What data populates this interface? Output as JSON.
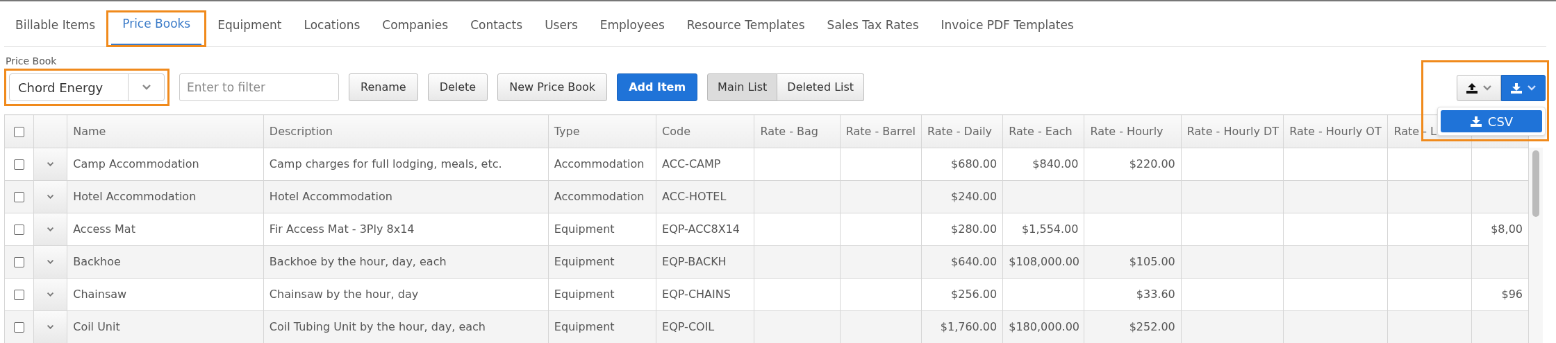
{
  "tabs": [
    {
      "label": "Billable Items",
      "selected": false,
      "highlighted": false
    },
    {
      "label": "Price Books",
      "selected": true,
      "highlighted": true
    },
    {
      "label": "Equipment",
      "selected": false,
      "highlighted": false
    },
    {
      "label": "Locations",
      "selected": false,
      "highlighted": false
    },
    {
      "label": "Companies",
      "selected": false,
      "highlighted": false
    },
    {
      "label": "Contacts",
      "selected": false,
      "highlighted": false
    },
    {
      "label": "Users",
      "selected": false,
      "highlighted": false
    },
    {
      "label": "Employees",
      "selected": false,
      "highlighted": false
    },
    {
      "label": "Resource Templates",
      "selected": false,
      "highlighted": false
    },
    {
      "label": "Sales Tax Rates",
      "selected": false,
      "highlighted": false
    },
    {
      "label": "Invoice PDF Templates",
      "selected": false,
      "highlighted": false
    }
  ],
  "price_book": {
    "label": "Price Book",
    "value": "Chord Energy",
    "highlighted": true
  },
  "filter": {
    "placeholder": "Enter to filter"
  },
  "buttons": [
    {
      "label": "Rename",
      "kind": "default"
    },
    {
      "label": "Delete",
      "kind": "default"
    },
    {
      "label": "New Price Book",
      "kind": "default"
    },
    {
      "label": "Add Item",
      "kind": "primary"
    }
  ],
  "list_toggle": [
    {
      "label": "Main List",
      "selected": true
    },
    {
      "label": "Deleted List",
      "selected": false
    }
  ],
  "export": {
    "highlighted": true,
    "menu": [
      {
        "label": "CSV"
      }
    ]
  },
  "table": {
    "all_checked": false,
    "columns": [
      "Name",
      "Description",
      "Type",
      "Code",
      "Rate - Bag",
      "Rate - Barrel",
      "Rate - Daily",
      "Rate - Each",
      "Rate - Hourly",
      "Rate - Hourly DT",
      "Rate - Hourly OT",
      "Rate - L"
    ],
    "rows": [
      {
        "checked": false,
        "cells": [
          "Camp Accommodation",
          "Camp charges for full lodging, meals, etc.",
          "Accommodation",
          "ACC-CAMP",
          null,
          null,
          "$680.00",
          "$840.00",
          "$220.00",
          null,
          null,
          null,
          null
        ]
      },
      {
        "checked": false,
        "cells": [
          "Hotel Accommodation",
          "Hotel Accommodation",
          "Accommodation",
          "ACC-HOTEL",
          null,
          null,
          "$240.00",
          null,
          null,
          null,
          null,
          null,
          null
        ]
      },
      {
        "checked": false,
        "cells": [
          "Access Mat",
          "Fir Access Mat - 3Ply 8x14",
          "Equipment",
          "EQP-ACC8X14",
          null,
          null,
          "$280.00",
          "$1,554.00",
          null,
          null,
          null,
          null,
          "$8,00"
        ]
      },
      {
        "checked": false,
        "cells": [
          "Backhoe",
          "Backhoe by the hour, day, each",
          "Equipment",
          "EQP-BACKH",
          null,
          null,
          "$640.00",
          "$108,000.00",
          "$105.00",
          null,
          null,
          null,
          null
        ]
      },
      {
        "checked": false,
        "cells": [
          "Chainsaw",
          "Chainsaw by the hour, day",
          "Equipment",
          "EQP-CHAINS",
          null,
          null,
          "$256.00",
          null,
          "$33.60",
          null,
          null,
          null,
          "$96"
        ]
      },
      {
        "checked": false,
        "cells": [
          "Coil Unit",
          "Coil Tubing Unit by the hour, day, each",
          "Equipment",
          "EQP-COIL",
          null,
          null,
          "$1,760.00",
          "$180,000.00",
          "$252.00",
          null,
          null,
          null,
          null
        ]
      }
    ]
  }
}
